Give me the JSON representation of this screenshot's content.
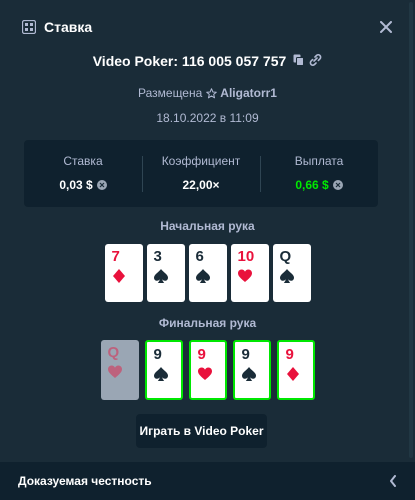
{
  "header": {
    "title": "Ставка",
    "title_icon": "bet-slip-icon",
    "close_icon": "close-icon"
  },
  "game": {
    "id_text": "Video Poker: 116 005 057 757",
    "placed_prefix": "Размещена",
    "user": "Aligatorr1",
    "date": "18.10.2022 в 11:09"
  },
  "stats": {
    "bet_label": "Ставка",
    "bet_value": "0,03 $",
    "multiplier_label": "Коэффициент",
    "multiplier_value": "22,00×",
    "payout_label": "Выплата",
    "payout_value": "0,66 $",
    "payout_color": "#00e701"
  },
  "initial_hand": {
    "label": "Начальная рука",
    "cards": [
      {
        "rank": "7",
        "suit": "diamond",
        "color": "red"
      },
      {
        "rank": "3",
        "suit": "spade",
        "color": "black"
      },
      {
        "rank": "6",
        "suit": "spade",
        "color": "black"
      },
      {
        "rank": "10",
        "suit": "heart",
        "color": "red"
      },
      {
        "rank": "Q",
        "suit": "spade",
        "color": "black"
      }
    ]
  },
  "final_hand": {
    "label": "Финальная рука",
    "cards": [
      {
        "rank": "Q",
        "suit": "heart",
        "color": "red",
        "state": "discard"
      },
      {
        "rank": "9",
        "suit": "spade",
        "color": "black",
        "state": "held"
      },
      {
        "rank": "9",
        "suit": "heart",
        "color": "red",
        "state": "held"
      },
      {
        "rank": "9",
        "suit": "spade",
        "color": "black",
        "state": "held"
      },
      {
        "rank": "9",
        "suit": "diamond",
        "color": "red",
        "state": "held"
      }
    ]
  },
  "play_button": "Играть в Video Poker",
  "footer": {
    "title": "Доказуемая честность"
  }
}
